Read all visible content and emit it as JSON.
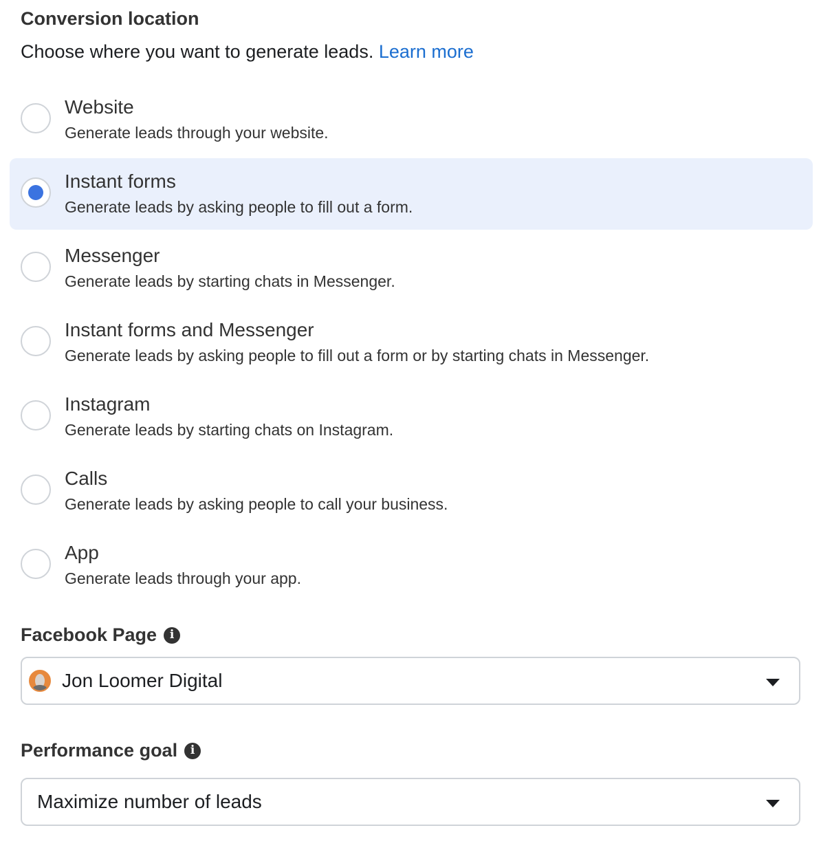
{
  "conversion_location": {
    "title": "Conversion location",
    "subtitle": "Choose where you want to generate leads.",
    "learn_more": "Learn more",
    "options": [
      {
        "title": "Website",
        "description": "Generate leads through your website.",
        "selected": false
      },
      {
        "title": "Instant forms",
        "description": "Generate leads by asking people to fill out a form.",
        "selected": true
      },
      {
        "title": "Messenger",
        "description": "Generate leads by starting chats in Messenger.",
        "selected": false
      },
      {
        "title": "Instant forms and Messenger",
        "description": "Generate leads by asking people to fill out a form or by starting chats in Messenger.",
        "selected": false
      },
      {
        "title": "Instagram",
        "description": "Generate leads by starting chats on Instagram.",
        "selected": false
      },
      {
        "title": "Calls",
        "description": "Generate leads by asking people to call your business.",
        "selected": false
      },
      {
        "title": "App",
        "description": "Generate leads through your app.",
        "selected": false
      }
    ]
  },
  "facebook_page": {
    "label": "Facebook Page",
    "value": "Jon Loomer Digital"
  },
  "performance_goal": {
    "label": "Performance goal",
    "value": "Maximize number of leads"
  },
  "colors": {
    "accent": "#3b73e0",
    "link": "#1b6ed0",
    "selected_bg": "#eaf0fc"
  },
  "icons": {
    "info": "info-icon",
    "dropdown": "caret-down-icon",
    "avatar": "page-avatar"
  }
}
